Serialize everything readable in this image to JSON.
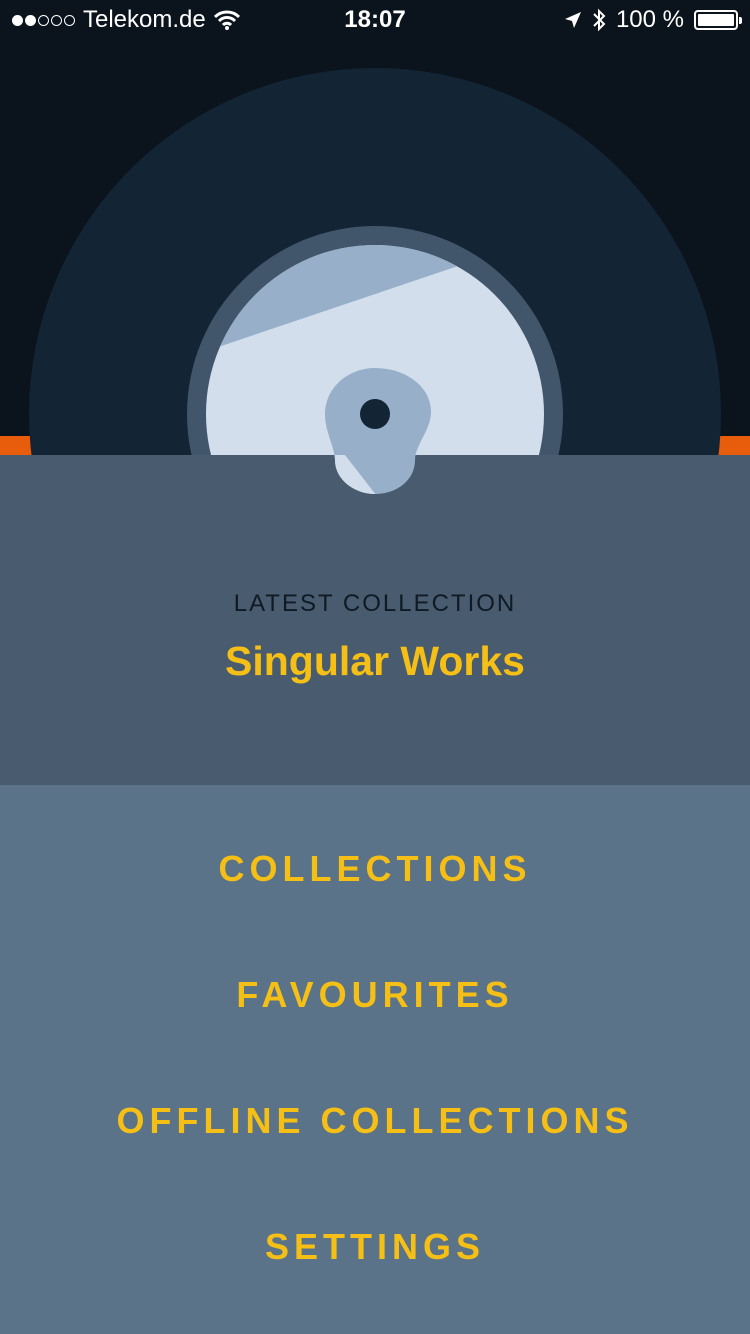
{
  "status_bar": {
    "carrier": "Telekom.de",
    "time": "18:07",
    "battery": "100 %",
    "signal_bars_filled": 2,
    "signal_bars_total": 5,
    "icons": [
      "wifi-icon",
      "location-arrow-icon",
      "bluetooth-icon",
      "battery-icon"
    ]
  },
  "hero": {
    "icons": [
      "vinyl-record-icon",
      "tonearm-icon"
    ]
  },
  "latest": {
    "label": "LATEST COLLECTION",
    "title": "Singular Works"
  },
  "menu": {
    "items": [
      {
        "label": "COLLECTIONS"
      },
      {
        "label": "FAVOURITES"
      },
      {
        "label": "OFFLINE COLLECTIONS"
      },
      {
        "label": "SETTINGS"
      }
    ]
  },
  "colors": {
    "background": "#0b141d",
    "record": "#132434",
    "accent_orange": "#e85d0c",
    "panel": "#485b6f",
    "menu": "#5b7388",
    "highlight": "#f5bf16"
  }
}
